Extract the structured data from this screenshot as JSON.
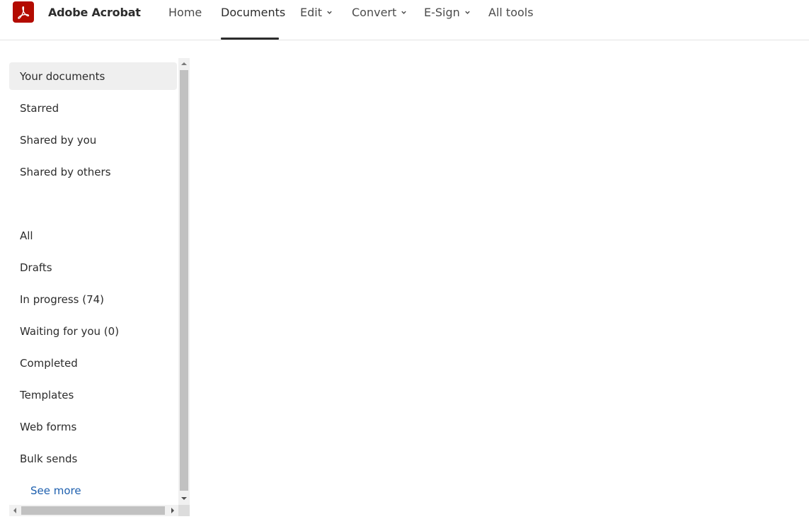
{
  "app": {
    "name": "Adobe Acrobat",
    "brand_color": "#b30b00",
    "logo_icon": "acrobat-logo-icon"
  },
  "nav": {
    "items": [
      {
        "label": "Home",
        "has_dropdown": false,
        "active": false
      },
      {
        "label": "Documents",
        "has_dropdown": false,
        "active": true
      },
      {
        "label": "Edit",
        "has_dropdown": true,
        "active": false
      },
      {
        "label": "Convert",
        "has_dropdown": true,
        "active": false
      },
      {
        "label": "E-Sign",
        "has_dropdown": true,
        "active": false
      },
      {
        "label": "All tools",
        "has_dropdown": false,
        "active": false
      }
    ],
    "dropdown_icon": "chevron-down-icon"
  },
  "sidebar": {
    "top_items": [
      {
        "label": "Your documents",
        "selected": true
      },
      {
        "label": "Starred",
        "selected": false
      },
      {
        "label": "Shared by you",
        "selected": false
      },
      {
        "label": "Shared by others",
        "selected": false
      }
    ],
    "agreement_items": [
      {
        "label": "All"
      },
      {
        "label": "Drafts"
      },
      {
        "label": "In progress (74)"
      },
      {
        "label": "Waiting for you (0)"
      },
      {
        "label": "Completed"
      },
      {
        "label": "Templates"
      },
      {
        "label": "Web forms"
      },
      {
        "label": "Bulk sends"
      }
    ],
    "see_more": "See more",
    "link_color": "#1d5fae",
    "selected_bg": "#efefef"
  }
}
